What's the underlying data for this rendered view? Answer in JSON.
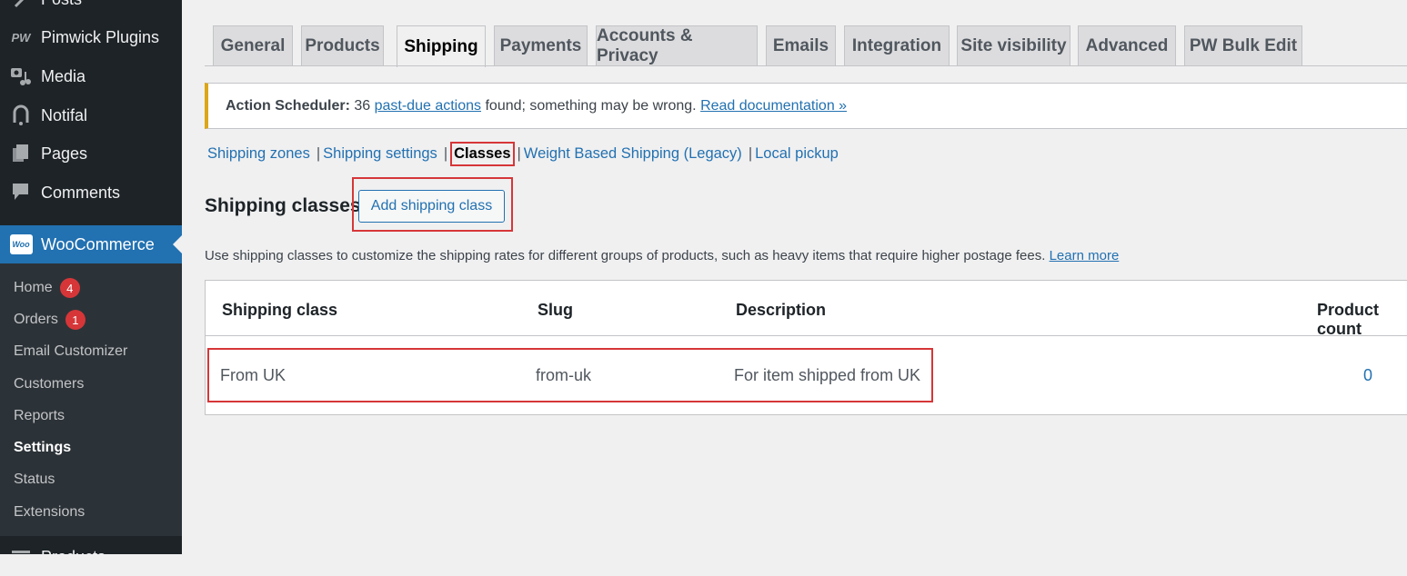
{
  "sidebar": {
    "items": [
      {
        "label": "Posts",
        "icon": "pin-icon"
      },
      {
        "label": "Pimwick Plugins",
        "icon": "pw-icon"
      },
      {
        "label": "Media",
        "icon": "media-icon"
      },
      {
        "label": "Notifal",
        "icon": "bell-icon"
      },
      {
        "label": "Pages",
        "icon": "pages-icon"
      },
      {
        "label": "Comments",
        "icon": "comment-icon"
      },
      {
        "label": "WooCommerce",
        "icon": "woo-icon",
        "active": true
      },
      {
        "label": "Products",
        "icon": "products-icon"
      }
    ],
    "woo_logo_text": "Woo",
    "submenu": [
      {
        "label": "Home",
        "badge": "4"
      },
      {
        "label": "Orders",
        "badge": "1"
      },
      {
        "label": "Email Customizer"
      },
      {
        "label": "Customers"
      },
      {
        "label": "Reports"
      },
      {
        "label": "Settings",
        "current": true
      },
      {
        "label": "Status"
      },
      {
        "label": "Extensions"
      }
    ]
  },
  "tabs": [
    {
      "label": "General"
    },
    {
      "label": "Products"
    },
    {
      "label": "Shipping",
      "active": true
    },
    {
      "label": "Payments"
    },
    {
      "label": "Accounts & Privacy"
    },
    {
      "label": "Emails"
    },
    {
      "label": "Integration"
    },
    {
      "label": "Site visibility"
    },
    {
      "label": "Advanced"
    },
    {
      "label": "PW Bulk Edit"
    }
  ],
  "notice": {
    "prefix": "Action Scheduler:",
    "count": "36",
    "link1": "past-due actions",
    "middle": "found; something may be wrong.",
    "link2": "Read documentation »",
    "accent": "#dba617"
  },
  "subnav": {
    "items": [
      "Shipping zones",
      "Shipping settings",
      "Classes",
      "Weight Based Shipping (Legacy)",
      "Local pickup"
    ],
    "separator": "|",
    "current": "Classes"
  },
  "section": {
    "title": "Shipping classes",
    "add_button": "Add shipping class",
    "description": "Use shipping classes to customize the shipping rates for different groups of products, such as heavy items that require higher postage fees.",
    "learn_more": "Learn more"
  },
  "table": {
    "headers": [
      "Shipping class",
      "Slug",
      "Description",
      "Product count"
    ],
    "rows": [
      {
        "name": "From UK",
        "slug": "from-uk",
        "description": "For item shipped from UK",
        "count": "0"
      }
    ]
  },
  "colors": {
    "brand": "#2271b1",
    "highlight": "#d63638",
    "sidebar_bg": "#1d2327"
  }
}
